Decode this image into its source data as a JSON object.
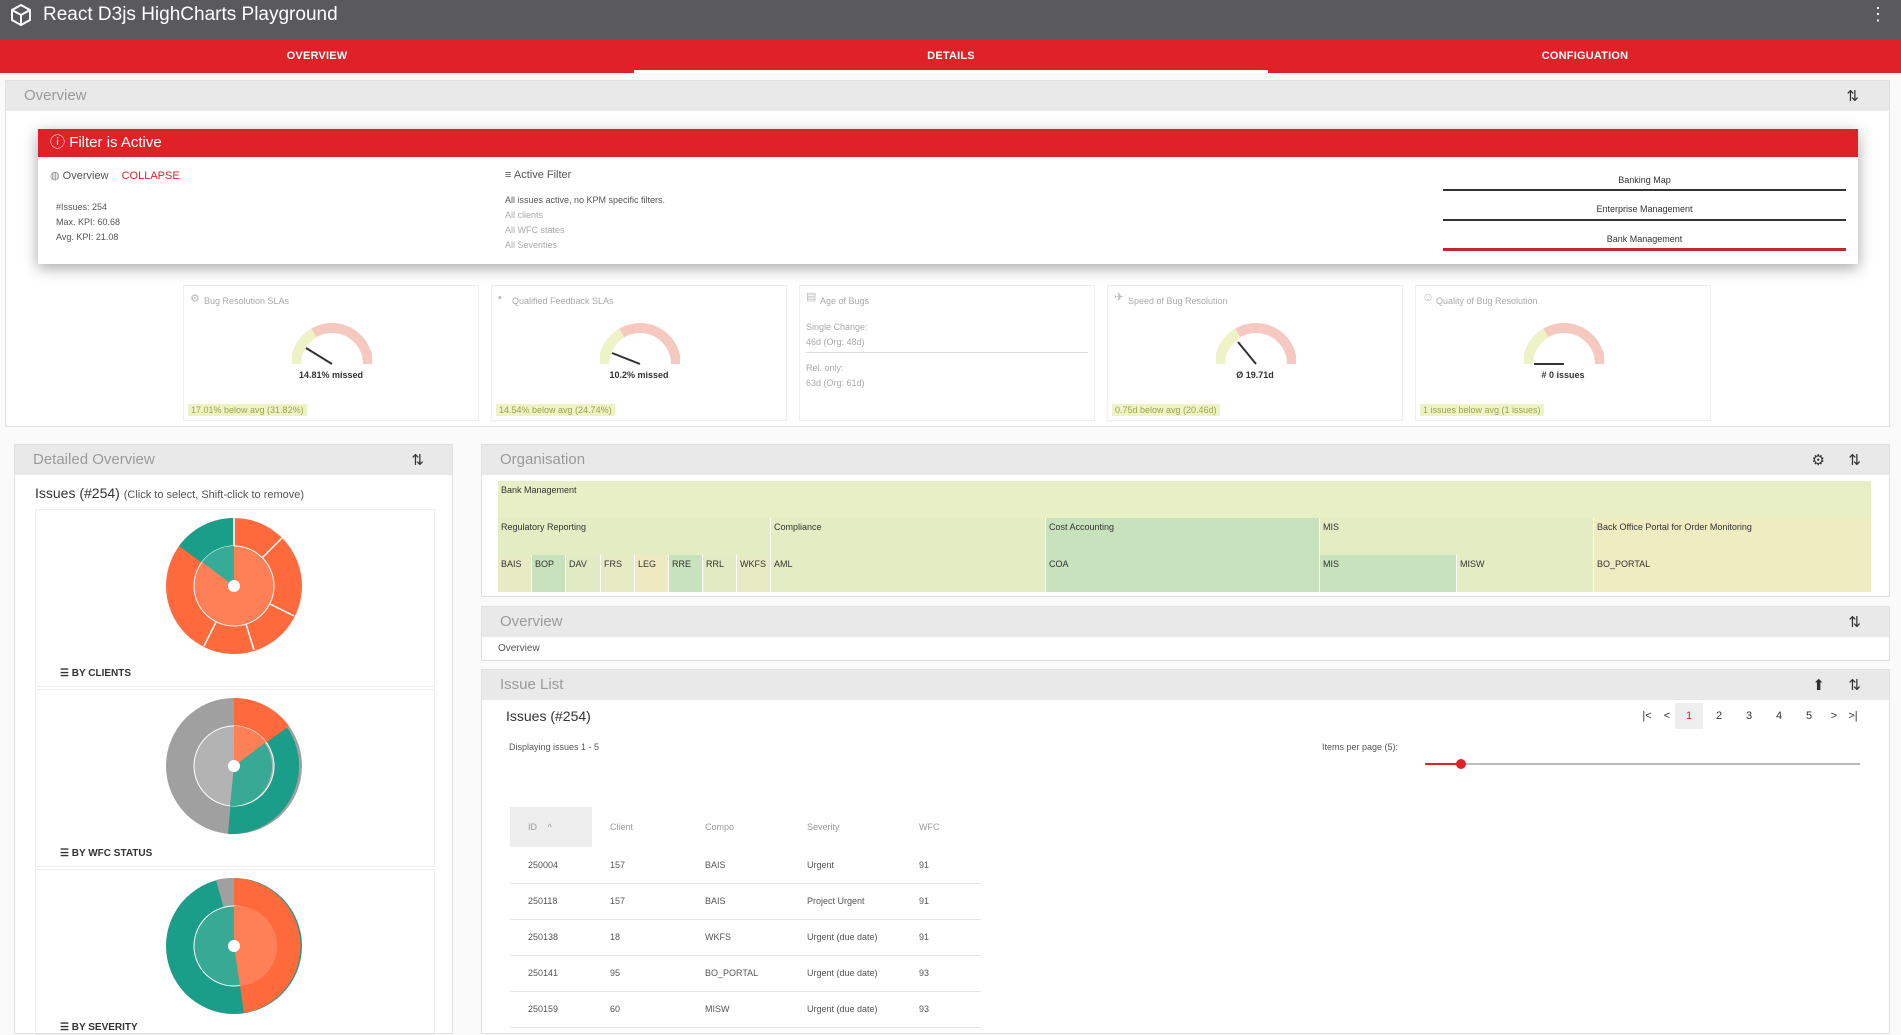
{
  "app": {
    "title": "React D3js HighCharts Playground"
  },
  "tabs": [
    {
      "label": "OVERVIEW"
    },
    {
      "label": "DETAILS"
    },
    {
      "label": "CONFIGUATION"
    }
  ],
  "overview_panel": {
    "title": "Overview"
  },
  "filter": {
    "header": "Filter is Active",
    "overview_label": "Overview",
    "collapse_label": "COLLAPSE",
    "stats": [
      "#Issues: 254",
      "Max. KPI: 60.68",
      "Avg. KPI: 21.08"
    ],
    "active_filter_label": "Active Filter",
    "active_text": "All issues active, no KPM specific filters.",
    "inactive": [
      "All clients",
      "All WFC states",
      "All Severities"
    ],
    "breadcrumb": [
      "Banking Map",
      "Enterprise Management",
      "Bank Management"
    ]
  },
  "kpis": [
    {
      "title": "Bug Resolution SLAs",
      "value": "14.81% missed",
      "foot": "17.01% below avg (31.82%)"
    },
    {
      "title": "Qualified Feedback SLAs",
      "value": "10.2% missed",
      "foot": "14.54% below avg (24.74%)"
    },
    {
      "title": "Age of Bugs",
      "line1": "Single Change:",
      "line2": "46d (Org: 48d)",
      "line3": "Rel. only:",
      "line4": "63d (Org: 61d)"
    },
    {
      "title": "Speed of Bug Resolution",
      "value": "Ø 19.71d",
      "foot": "0.75d below avg (20.46d)"
    },
    {
      "title": "Quality of Bug Resolution",
      "value": "# 0 issues",
      "foot": "1 issues below avg (1 issues)"
    }
  ],
  "detailed": {
    "title": "Detailed Overview",
    "issues_heading": "Issues (#254)",
    "issues_hint": "(Click to select, Shift-click to remove)",
    "charts": [
      "BY CLIENTS",
      "BY WFC STATUS",
      "BY SEVERITY"
    ]
  },
  "organisation": {
    "title": "Organisation",
    "root": "Bank Management",
    "level2": [
      "Regulatory Reporting",
      "Compliance",
      "Cost Accounting",
      "MIS",
      "Back Office Portal for Order Monitoring"
    ],
    "level3": [
      "BAIS",
      "BOP",
      "DAV",
      "FRS",
      "LEG",
      "RRE",
      "RRL",
      "WKFS",
      "AML",
      "COA",
      "MIS",
      "MISW",
      "BO_PORTAL"
    ]
  },
  "overview2": {
    "title": "Overview",
    "text": "Overview"
  },
  "issue_list": {
    "title": "Issue List",
    "heading": "Issues (#254)",
    "displaying": "Displaying issues 1 - 5",
    "items_per_page": "Items per page (5):",
    "pages": [
      "1",
      "2",
      "3",
      "4",
      "5"
    ],
    "columns": [
      "ID",
      "Client",
      "Compo",
      "Severity",
      "WFC"
    ],
    "rows": [
      [
        "250004",
        "157",
        "BAIS",
        "Urgent",
        "91"
      ],
      [
        "250118",
        "157",
        "BAIS",
        "Project Urgent",
        "91"
      ],
      [
        "250138",
        "18",
        "WKFS",
        "Urgent (due date)",
        "91"
      ],
      [
        "250141",
        "95",
        "BO_PORTAL",
        "Urgent (due date)",
        "93"
      ],
      [
        "250159",
        "60",
        "MISW",
        "Urgent (due date)",
        "93"
      ]
    ]
  },
  "colors": {
    "accent": "#e02127",
    "orange": "#ff6a3d",
    "teal": "#1a9e8a",
    "grey": "#a0a0a0"
  }
}
